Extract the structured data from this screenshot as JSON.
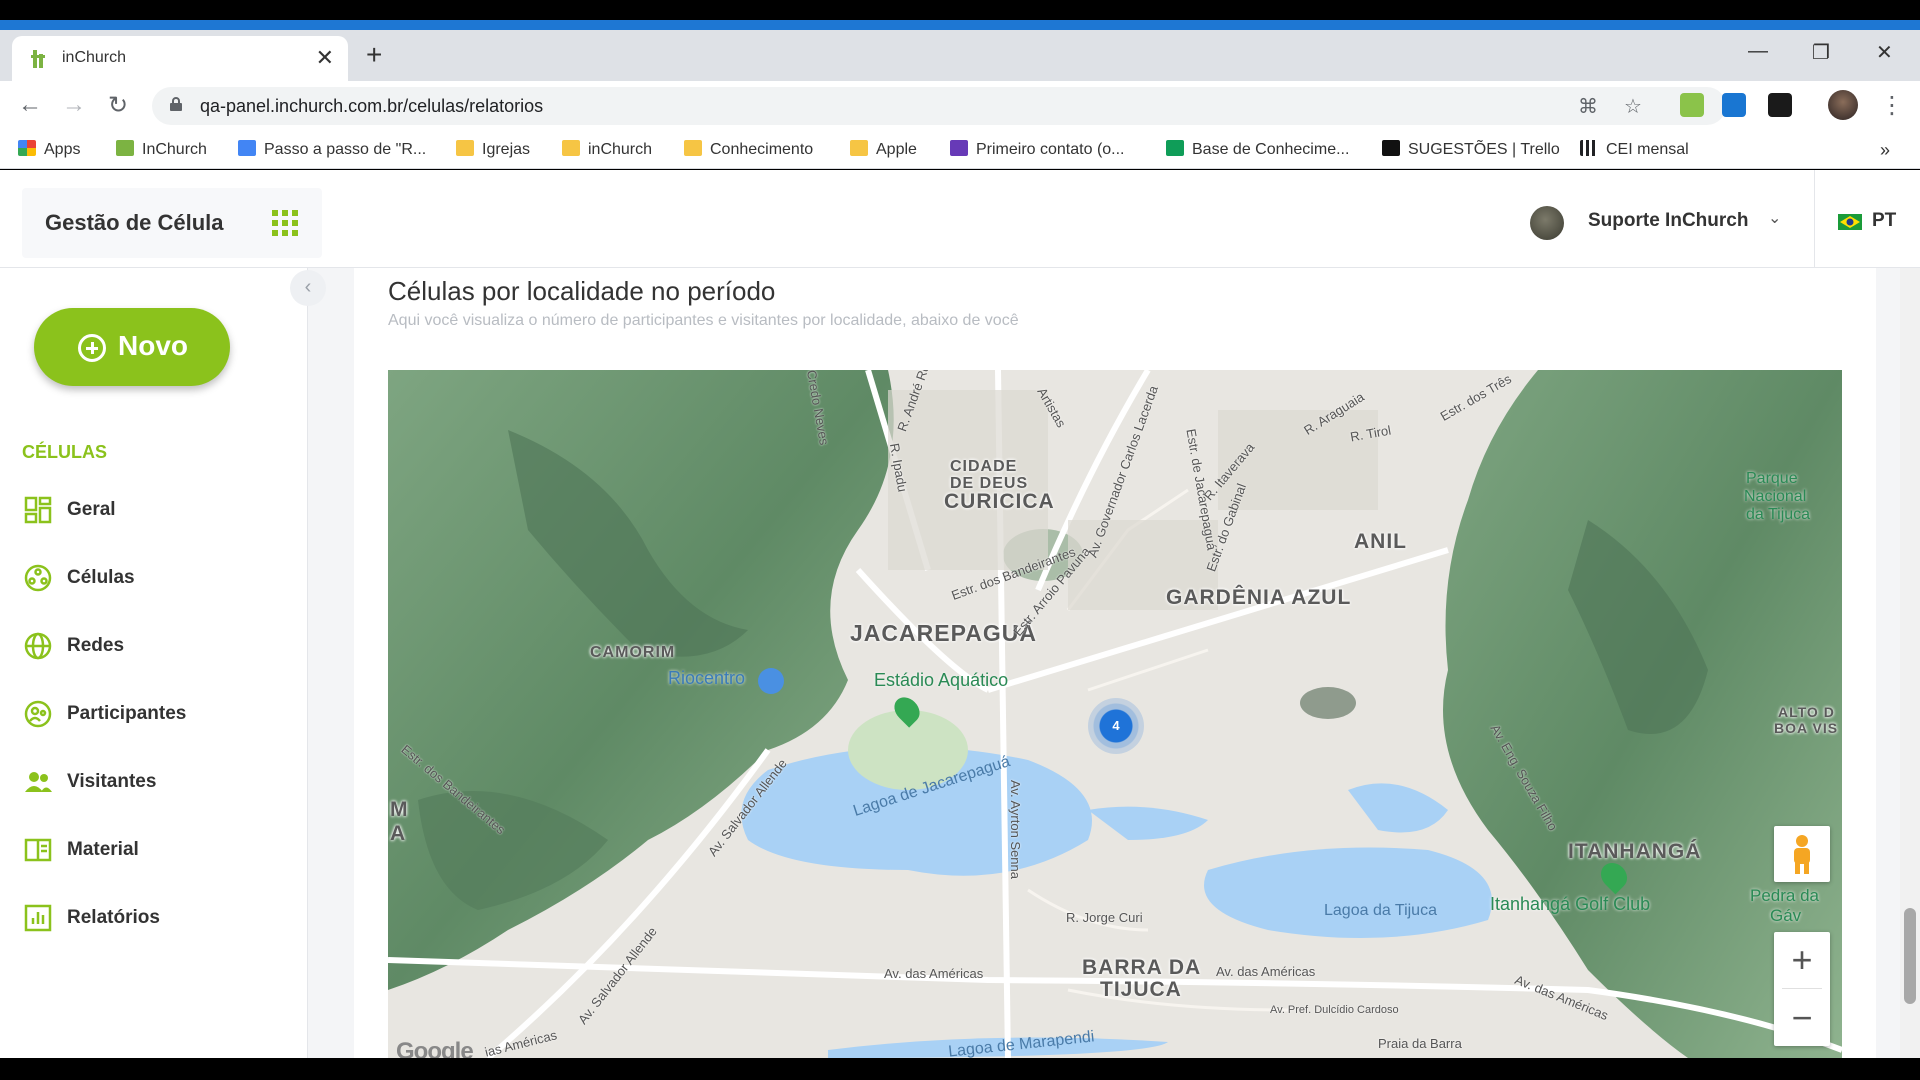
{
  "browser": {
    "tab_title": "inChurch",
    "url": "qa-panel.inchurch.com.br/celulas/relatorios",
    "bookmarks": [
      {
        "label": "Apps",
        "color": "#ea4335"
      },
      {
        "label": "InChurch",
        "color": "#7cb342"
      },
      {
        "label": "Passo a passo de \"R...",
        "color": "#4285f4"
      },
      {
        "label": "Igrejas",
        "color": "#f6c544"
      },
      {
        "label": "inChurch",
        "color": "#f6c544"
      },
      {
        "label": "Conhecimento",
        "color": "#f6c544"
      },
      {
        "label": "Apple",
        "color": "#f6c544"
      },
      {
        "label": "Primeiro contato (o...",
        "color": "#673ab7"
      },
      {
        "label": "Base de Conhecime...",
        "color": "#0f9d58"
      },
      {
        "label": "SUGESTÕES | Trello",
        "color": "#000000"
      },
      {
        "label": "CEI mensal",
        "color": "#202124"
      }
    ]
  },
  "header": {
    "brand": "Gestão de Célula",
    "user_name": "Suporte InChurch",
    "language": "PT"
  },
  "sidebar": {
    "new_button": "Novo",
    "section_title": "CÉLULAS",
    "items": [
      {
        "label": "Geral",
        "icon": "dashboard-icon"
      },
      {
        "label": "Células",
        "icon": "cells-icon"
      },
      {
        "label": "Redes",
        "icon": "globe-icon"
      },
      {
        "label": "Participantes",
        "icon": "participants-icon"
      },
      {
        "label": "Visitantes",
        "icon": "visitors-icon"
      },
      {
        "label": "Material",
        "icon": "book-icon"
      },
      {
        "label": "Relatórios",
        "icon": "chart-icon"
      }
    ]
  },
  "report": {
    "title": "Células por localidade no período",
    "subtitle": "Aqui você visualiza o número de participantes e visitantes por localidade, abaixo de você"
  },
  "map": {
    "cluster_count": "4",
    "attribution": "Google",
    "areas": [
      "CIDADE",
      "DE DEUS",
      "CURICICA",
      "ANIL",
      "GARDÊNIA AZUL",
      "JACAREPAGUÁ",
      "CAMORIM",
      "BARRA DA",
      "TIJUCA",
      "ITANHANGÁ",
      "ALTO D",
      "BOA VIS",
      "M",
      "A"
    ],
    "pois": [
      "Riocentro",
      "Estádio Aquático",
      "Itanhangá Golf Club",
      "Parque",
      "Nacional",
      "da Tijuca",
      "Pedra da",
      "Gáv"
    ],
    "waters": [
      "Lagoa de Jacarepaguá",
      "Lagoa da Tijuca",
      "Lagoa de Marapendi"
    ],
    "streets": [
      "Av. das Américas",
      "Av. das Américas",
      "Av. das Américas",
      "Av. Salvador Allende",
      "Av. Salvador Allende",
      "Av. Ayrton Senna",
      "R. Jorge Curi",
      "Av. Pref. Dulcídio Cardoso",
      "Estr. dos Bandeirantes",
      "Estr. Arroio Pavuna",
      "Av. Governador Carlos Lacerda",
      "Estr. do Gabinal",
      "R. Araguaia",
      "R. Tirol",
      "Estr. dos Três",
      "Av. Eng. Souza Filho",
      "Estr. de Jacarepaguá",
      "R. Itaverava",
      "R. André Ro",
      "Credo Neves",
      "Estr. dos Bandeirantes",
      "Artistas",
      "R. Ipadu",
      "ias Américas",
      "Praia da Barra"
    ]
  }
}
